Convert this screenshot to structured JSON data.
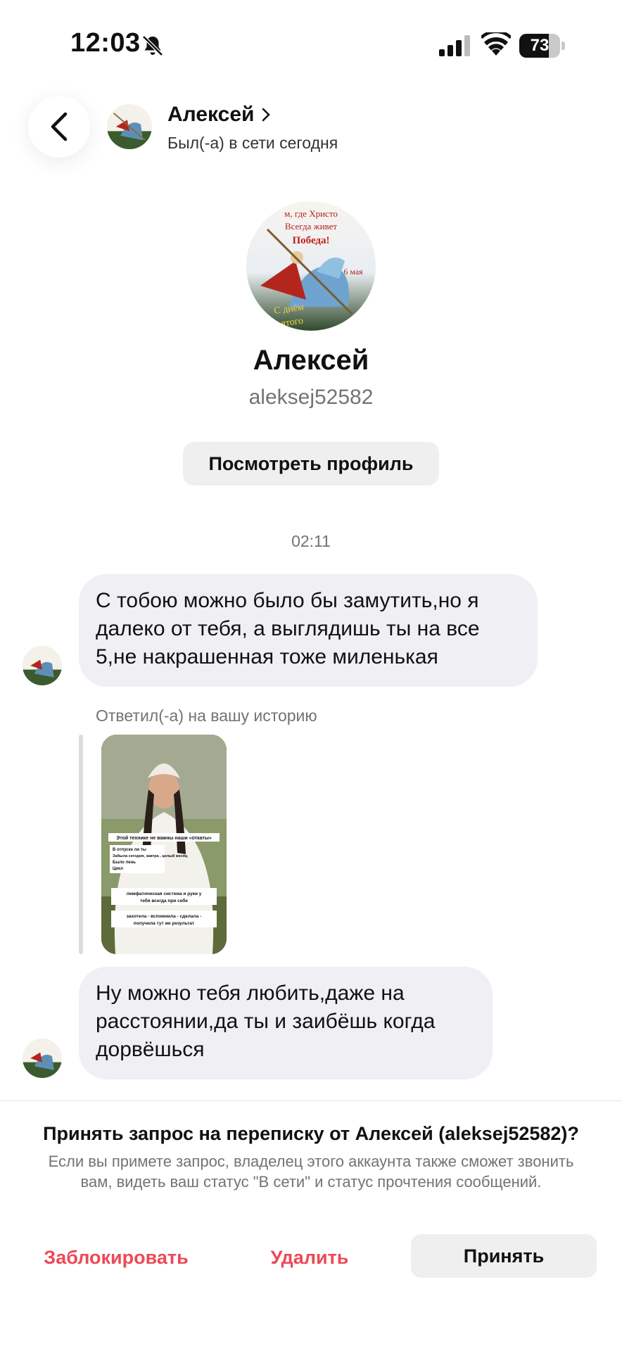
{
  "status_bar": {
    "time": "12:03",
    "battery": "73",
    "battery_level": 0.73
  },
  "header": {
    "name": "Алексей",
    "status": "Был(-а) в сети сегодня"
  },
  "avatar_picture": {
    "line1": "м, где Христо",
    "line2": "Всегда живет",
    "line3": "Победа!",
    "line4": "6 мая",
    "line5": "С днём",
    "line6": "ятого"
  },
  "profile": {
    "name": "Алексей",
    "username": "aleksej52582",
    "view_profile_label": "Посмотреть профиль"
  },
  "chat": {
    "timestamp": "02:11",
    "message1_lines": [
      "С тобою можно было бы замутить,но я",
      "далеко от тебя, а выглядишь ты на все",
      "5,не накрашенная тоже миленькая"
    ],
    "reply_label": "Ответил(-а) на вашу историю",
    "message2_lines": [
      "Ну можно тебя любить,даже на",
      "расстоянии,да ты и заибёшь когда",
      "дорвёшься"
    ]
  },
  "story": {
    "caption1": "Этой технике не важны наши «откаты»",
    "caption2": "В отпуске ли ты",
    "caption3": "Забыла сегодня, завтра , целый месяц",
    "caption4": "Было лень",
    "caption5": "Цикл",
    "caption6": "лимфатическая система и руки у",
    "caption7": "тебя всегда при себе",
    "caption8": "захотела - вспомнила - сделала -",
    "caption9": "получила тут же результат"
  },
  "request": {
    "title": "Принять запрос на переписку от Алексей (aleksej52582)?",
    "description": "Если вы примете запрос, владелец этого аккаунта также сможет звонить вам, видеть ваш статус \"В сети\" и статус прочтения сообщений.",
    "block_label": "Заблокировать",
    "delete_label": "Удалить",
    "accept_label": "Принять"
  },
  "colors": {
    "danger": "#ed4956",
    "bubble": "#efeff4",
    "secondary_text": "#737373"
  }
}
